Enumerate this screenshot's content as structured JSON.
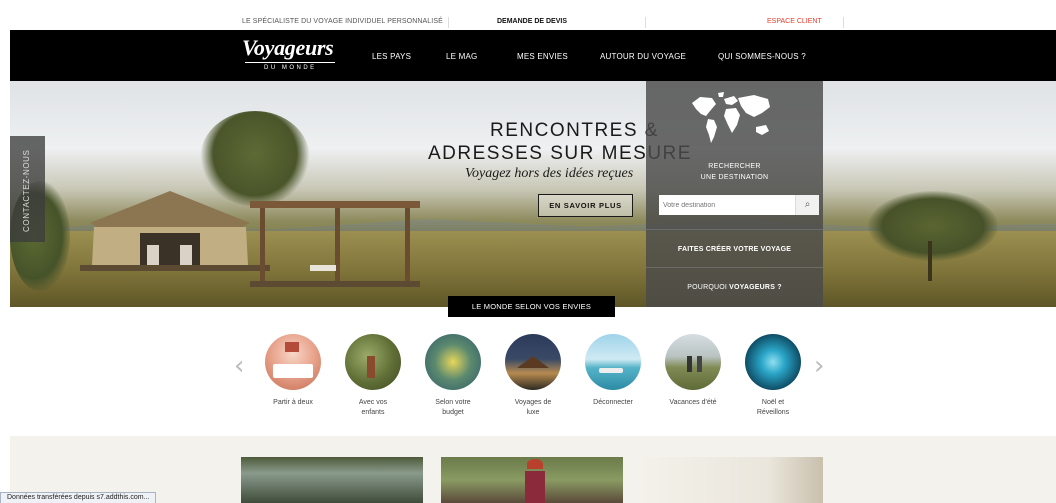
{
  "topbar": {
    "tagline": "LE SPÉCIALISTE DU VOYAGE INDIVIDUEL PERSONNALISÉ",
    "quote": "DEMANDE DE DEVIS",
    "client": "ESPACE CLIENT"
  },
  "logo": {
    "main": "Voyageurs",
    "sub": "DU MONDE"
  },
  "nav": [
    "LES PAYS",
    "LE MAG",
    "MES ENVIES",
    "AUTOUR DU VOYAGE",
    "QUI SOMMES-NOUS ?"
  ],
  "hero": {
    "title_line1": "RENCONTRES &",
    "title_line2": "ADRESSES SUR MESURE",
    "tagline": "Voyagez hors des idées reçues",
    "cta": "EN SAVOIR PLUS",
    "contact": "CONTACTEZ-NOUS"
  },
  "search": {
    "label1": "RECHERCHER",
    "label2": "UNE DESTINATION",
    "placeholder": "Votre destination",
    "create": "FAITES CRÉER VOTRE VOYAGE",
    "why_prefix": "POURQUOI",
    "why_bold": "VOYAGEURS ?"
  },
  "section_label": "LE MONDE SELON VOS ENVIES",
  "categories": [
    {
      "l1": "Partir à deux",
      "l2": ""
    },
    {
      "l1": "Avec vos",
      "l2": "enfants"
    },
    {
      "l1": "Selon votre",
      "l2": "budget"
    },
    {
      "l1": "Voyages de",
      "l2": "luxe"
    },
    {
      "l1": "Déconnecter",
      "l2": ""
    },
    {
      "l1": "Vacances d'été",
      "l2": ""
    },
    {
      "l1": "Noël et",
      "l2": "Réveillons"
    }
  ],
  "status_bar": "Données transférées depuis s7.addthis.com..."
}
